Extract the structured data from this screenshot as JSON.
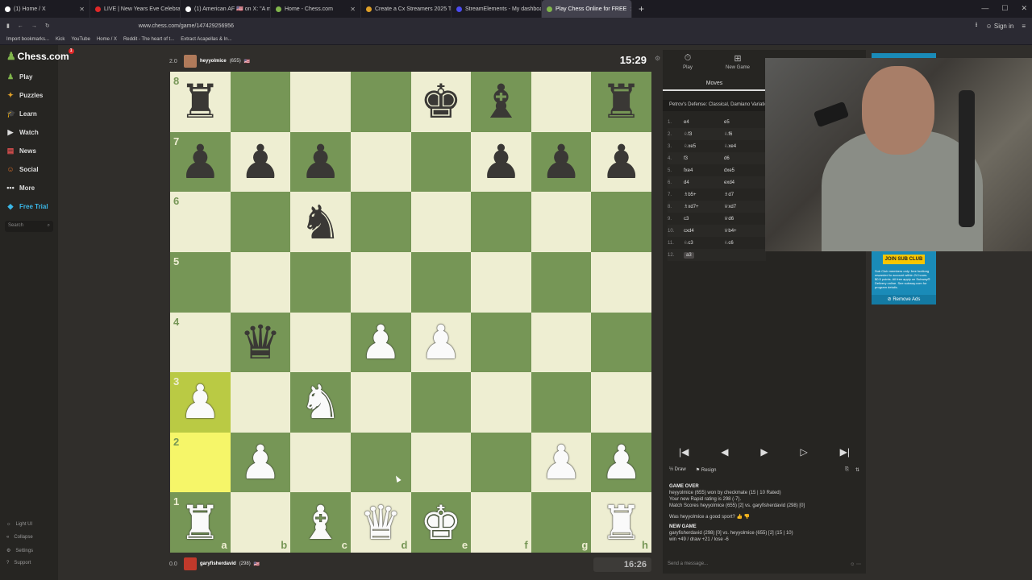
{
  "browser": {
    "tabs": [
      {
        "label": "(1) Home / X",
        "color": "#ffffff"
      },
      {
        "label": "LIVE | New Years Eve Celebratio",
        "color": "#e02828"
      },
      {
        "label": "(1) American AF 🇺🇸 on X: \"A mi",
        "color": "#ffffff"
      },
      {
        "label": "Home - Chess.com",
        "color": "#81b64c"
      },
      {
        "label": "Create a Cx Streamers 2025 Tie",
        "color": "#e0a028"
      },
      {
        "label": "StreamElements - My dashboar",
        "color": "#4b4bf0"
      },
      {
        "label": "Play Chess Online for FREE",
        "color": "#81b64c"
      }
    ],
    "url": "www.chess.com/game/147429256956",
    "bookmarks": [
      "Import bookmarks...",
      "Kick",
      "YouTube",
      "Home / X",
      "Reddit - The heart of t...",
      "Extract Acapellas & In..."
    ],
    "signin": "Sign in"
  },
  "sidebar": {
    "logo": "Chess.com",
    "badge": "1",
    "items": [
      {
        "label": "Play",
        "icon": "play-icon"
      },
      {
        "label": "Puzzles",
        "icon": "puzzle-icon"
      },
      {
        "label": "Learn",
        "icon": "learn-icon"
      },
      {
        "label": "Watch",
        "icon": "watch-icon"
      },
      {
        "label": "News",
        "icon": "news-icon"
      },
      {
        "label": "Social",
        "icon": "social-icon"
      },
      {
        "label": "More",
        "icon": "more-icon"
      },
      {
        "label": "Free Trial",
        "icon": "diamond-icon"
      }
    ],
    "search_placeholder": "Search",
    "bottom": [
      "Light UI",
      "Collapse",
      "Settings",
      "Support"
    ]
  },
  "top_player": {
    "name": "heyyolmice",
    "rating": "(655)",
    "score": "2.0",
    "clock": "15:29"
  },
  "bottom_player": {
    "name": "garyfisherdavid",
    "rating": "(298)",
    "score": "0.0",
    "clock": "16:26"
  },
  "board": {
    "ranks": [
      "8",
      "7",
      "6",
      "5",
      "4",
      "3",
      "2",
      "1"
    ],
    "files": [
      "a",
      "b",
      "c",
      "d",
      "e",
      "f",
      "g",
      "h"
    ],
    "position": [
      [
        "br",
        "",
        "",
        "",
        "bk",
        "bb",
        "",
        "br"
      ],
      [
        "bp",
        "bp",
        "bp",
        "",
        "",
        "bp",
        "bp",
        "bp"
      ],
      [
        "",
        "",
        "bn",
        "",
        "",
        "",
        "",
        ""
      ],
      [
        "",
        "",
        "",
        "",
        "",
        "",
        "",
        ""
      ],
      [
        "",
        "bq",
        "",
        "wp",
        "wp",
        "",
        "",
        ""
      ],
      [
        "wp",
        "",
        "wn",
        "",
        "",
        "",
        "",
        ""
      ],
      [
        "",
        "wp",
        "",
        "",
        "",
        "",
        "wp",
        "wp"
      ],
      [
        "wr",
        "",
        "wb",
        "wq",
        "wk",
        "",
        "",
        "wr"
      ]
    ],
    "highlights": [
      "a3",
      "a2"
    ]
  },
  "panel": {
    "tabs": [
      {
        "label": "Play",
        "icon": "play-clock-icon"
      },
      {
        "label": "New Game",
        "icon": "plus-icon"
      }
    ],
    "moves_label": "Moves",
    "opening": "Petrov's Defense: Classical, Damiano Variation",
    "moves": [
      {
        "n": "1.",
        "w": "e4",
        "b": "e5"
      },
      {
        "n": "2.",
        "w": "♘f3",
        "b": "♘f6"
      },
      {
        "n": "3.",
        "w": "♘xe5",
        "b": "♘xe4"
      },
      {
        "n": "4.",
        "w": "f3",
        "b": "d6"
      },
      {
        "n": "5.",
        "w": "fxe4",
        "b": "dxe5"
      },
      {
        "n": "6.",
        "w": "d4",
        "b": "exd4"
      },
      {
        "n": "7.",
        "w": "♗b5+",
        "b": "♗d7"
      },
      {
        "n": "8.",
        "w": "♗xd7+",
        "b": "♕xd7"
      },
      {
        "n": "9.",
        "w": "c3",
        "b": "♕d6"
      },
      {
        "n": "10.",
        "w": "cxd4",
        "b": "♕b4+"
      },
      {
        "n": "11.",
        "w": "♘c3",
        "b": "♘c6"
      },
      {
        "n": "12.",
        "w": "a3",
        "b": ""
      }
    ],
    "draw": "Draw",
    "resign": "Resign",
    "game_over": "GAME OVER",
    "result_lines": [
      "heyyolmice (655) won by checkmate (15 | 10 Rated)",
      "Your new Rapid rating is 298 (-7).",
      "Match Scores heyyolmice (655) [2] vs. garyfisherdavid (298) [0]"
    ],
    "sport_question": "Was heyyolmice a good sport?",
    "new_game": "NEW GAME",
    "new_game_line": "garyfisherdavid (298) [0] vs. heyyolmice (655) [2] (15 | 10)",
    "wdl": "win +49 / draw +21 / lose -6",
    "chat_placeholder": "Send a message..."
  },
  "ad": {
    "join": "JOIN SUB CLUB",
    "remove": "Remove Ads",
    "body": "Sub Club members only: free footlong rewarded to account within 24 hours. $0.5 points. All free apply on Subway® Delivery online. See subway.com for program details."
  },
  "colors": {
    "light_square": "#eeeed2",
    "dark_square": "#769656",
    "highlight": "#f6f669",
    "bg": "#302e2b"
  }
}
